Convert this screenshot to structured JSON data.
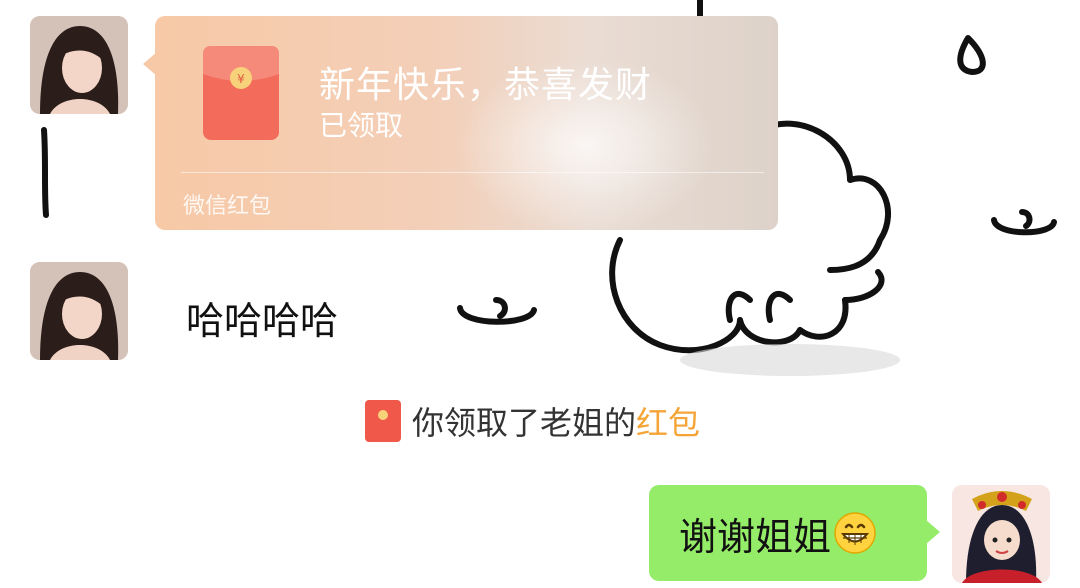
{
  "chat": {
    "red_packet": {
      "title": "新年快乐，恭喜发财",
      "status": "已领取",
      "source": "微信红包"
    },
    "message_text": "哈哈哈哈",
    "system_notice": {
      "prefix": "你领取了老姐的",
      "link": "红包"
    },
    "self_message": {
      "text": "谢谢姐姐",
      "emoji": "grin-emoji"
    }
  },
  "colors": {
    "self_bubble": "#95ec69",
    "red_packet_card": "#f7c9a6",
    "system_link": "#f5a437",
    "red_packet_icon": "#f26b5b"
  }
}
